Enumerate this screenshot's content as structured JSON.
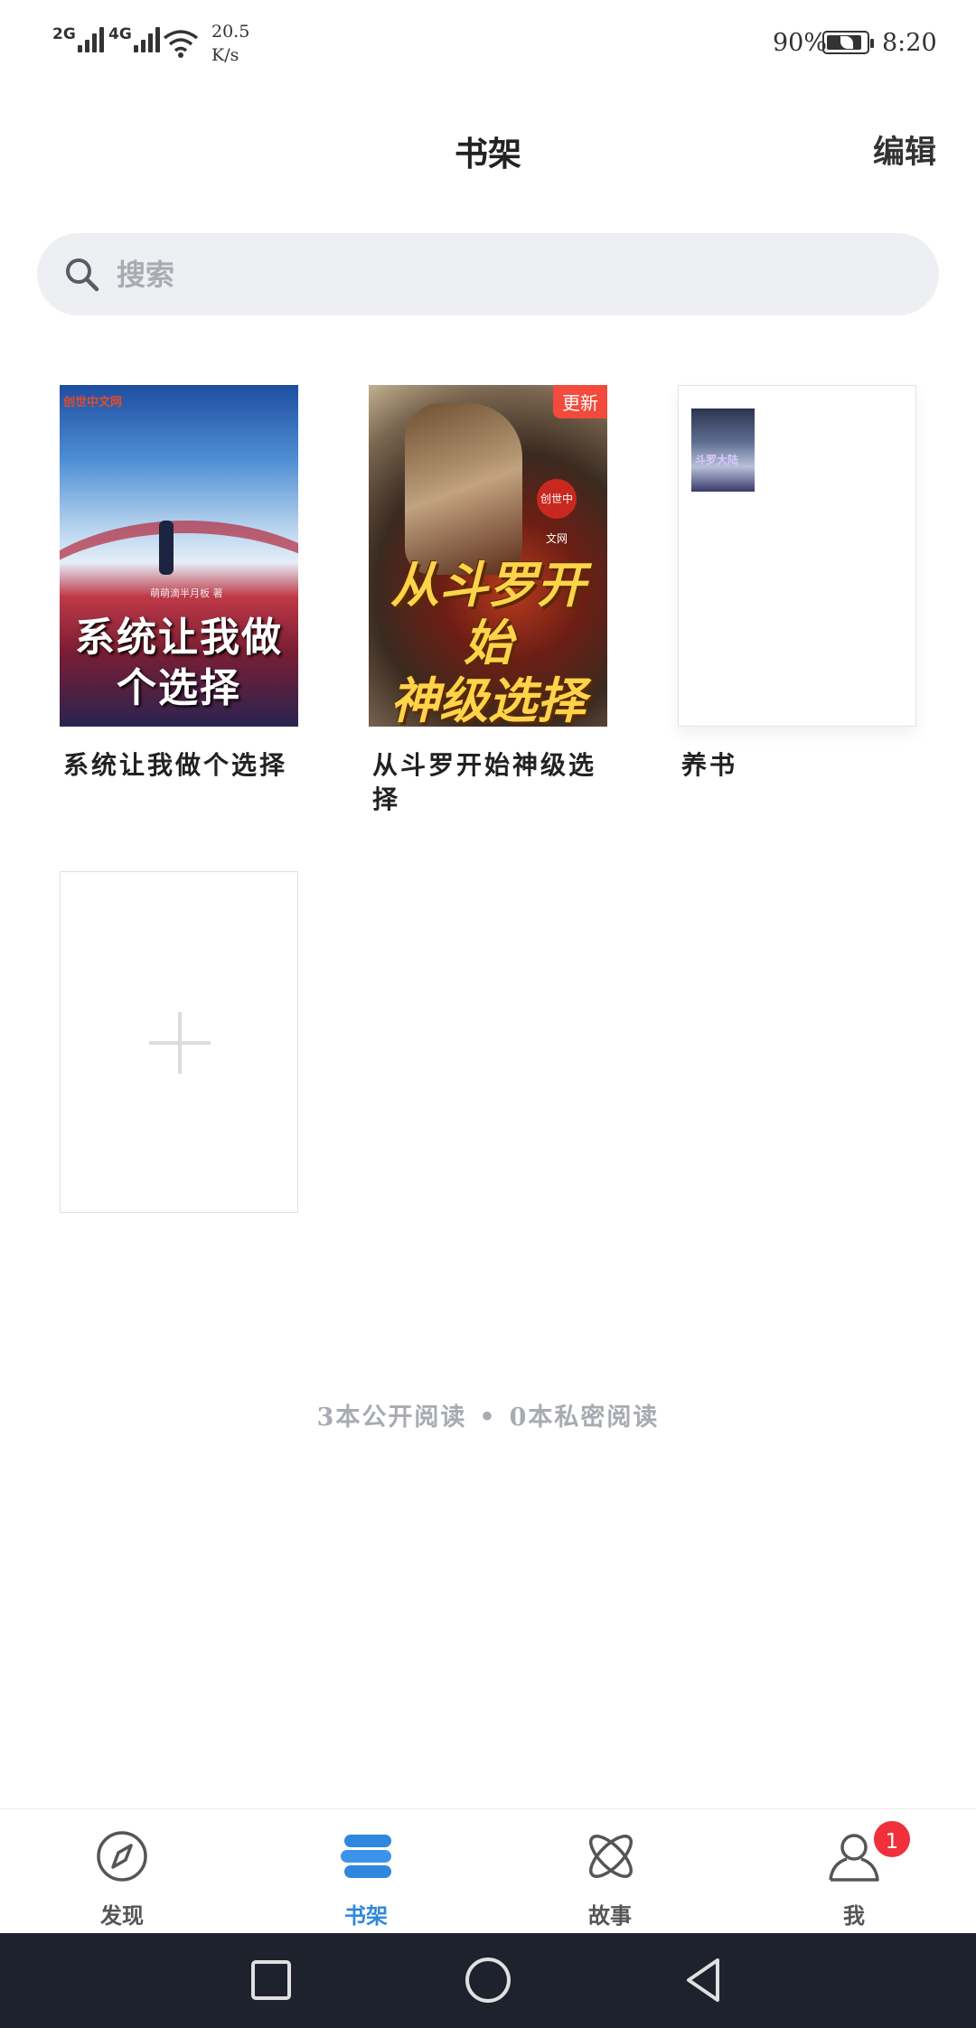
{
  "status_bar": {
    "sim1": "2G",
    "sim2": "4G",
    "net_speed_value": "20.5",
    "net_speed_unit": "K/s",
    "battery": "90%",
    "battery_level": 0.9,
    "time": "8:20"
  },
  "header": {
    "title": "书架",
    "edit_label": "编辑"
  },
  "search": {
    "placeholder": "搜索"
  },
  "books": [
    {
      "title": "系统让我做个选择",
      "cover_text": "系统让我做个选择",
      "cover_line1": "系统让我做",
      "cover_line2": "个选择",
      "cover_brand": "创世中文网",
      "cover_author": "萌萌滴半月板 著",
      "has_update": false
    },
    {
      "title": "从斗罗开始神级选择",
      "cover_line1": "从斗罗开始",
      "cover_line2": "神级选择",
      "cover_brand": "创世中文网",
      "has_update": true,
      "update_label": "更新"
    },
    {
      "title": "养书",
      "has_update": false,
      "thumb_text": "斗罗大陆"
    }
  ],
  "stats": {
    "public": "3本公开阅读",
    "separator": "•",
    "private": "0本私密阅读"
  },
  "bottom_nav": [
    {
      "label": "发现",
      "icon": "compass-icon",
      "active": false
    },
    {
      "label": "书架",
      "icon": "bookshelf-icon",
      "active": true
    },
    {
      "label": "故事",
      "icon": "atom-icon",
      "active": false
    },
    {
      "label": "我",
      "icon": "person-icon",
      "active": false,
      "badge": "1"
    }
  ],
  "colors": {
    "accent": "#2f87de",
    "badge_red": "#f0303a",
    "search_bg": "#eeeff2",
    "muted_text": "#a8abb2",
    "system_nav_bg": "#1e222c"
  }
}
